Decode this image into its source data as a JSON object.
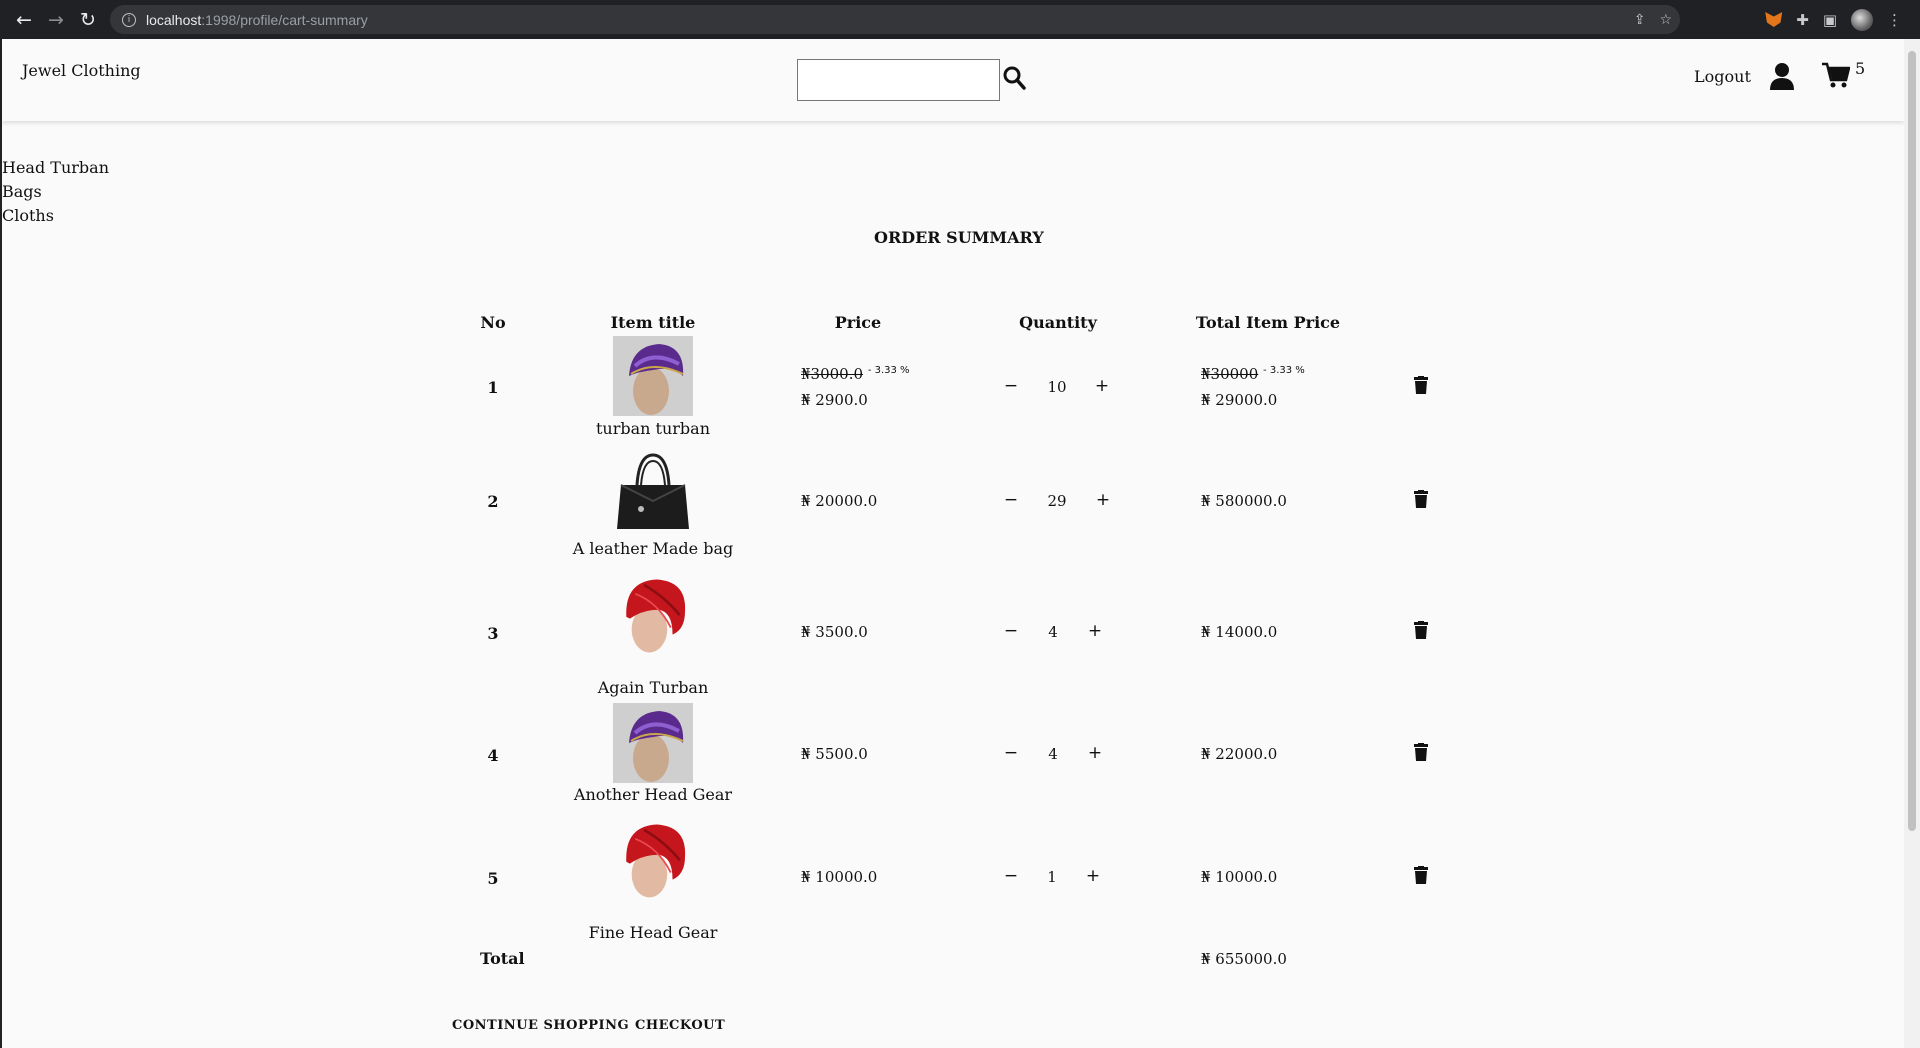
{
  "browser": {
    "url_host": "localhost",
    "url_rest": ":1998/profile/cart-summary"
  },
  "header": {
    "brand": "Jewel Clothing",
    "search_placeholder": "",
    "logout": "Logout",
    "cart_count": "5"
  },
  "categories": [
    "Head Turban",
    "Bags",
    "Cloths"
  ],
  "summary": {
    "title": "ORDER SUMMARY",
    "columns": [
      "No",
      "Item title",
      "Price",
      "Quantity",
      "Total Item Price"
    ],
    "rows": [
      {
        "no": "1",
        "title": "turban turban",
        "old_price": "₦3000.0",
        "discount": "- 3.33 %",
        "price": "₦ 2900.0",
        "qty": "10",
        "old_total": "₦30000",
        "total_discount": "- 3.33 %",
        "total": "₦ 29000.0",
        "image": "purple-turban"
      },
      {
        "no": "2",
        "title": "A leather Made bag",
        "price": "₦ 20000.0",
        "qty": "29",
        "total": "₦ 580000.0",
        "image": "black-bag"
      },
      {
        "no": "3",
        "title": "Again Turban",
        "price": "₦ 3500.0",
        "qty": "4",
        "total": "₦ 14000.0",
        "image": "red-turban"
      },
      {
        "no": "4",
        "title": "Another Head Gear",
        "price": "₦ 5500.0",
        "qty": "4",
        "total": "₦ 22000.0",
        "image": "purple-turban"
      },
      {
        "no": "5",
        "title": "Fine Head Gear",
        "price": "₦ 10000.0",
        "qty": "1",
        "total": "₦ 10000.0",
        "image": "red-turban"
      }
    ],
    "total_label": "Total",
    "total_value": "₦ 655000.0",
    "qty_minus": "−",
    "qty_plus": "+"
  },
  "actions": {
    "continue": "CONTINUE SHOPPING",
    "checkout": "CHECKOUT"
  }
}
